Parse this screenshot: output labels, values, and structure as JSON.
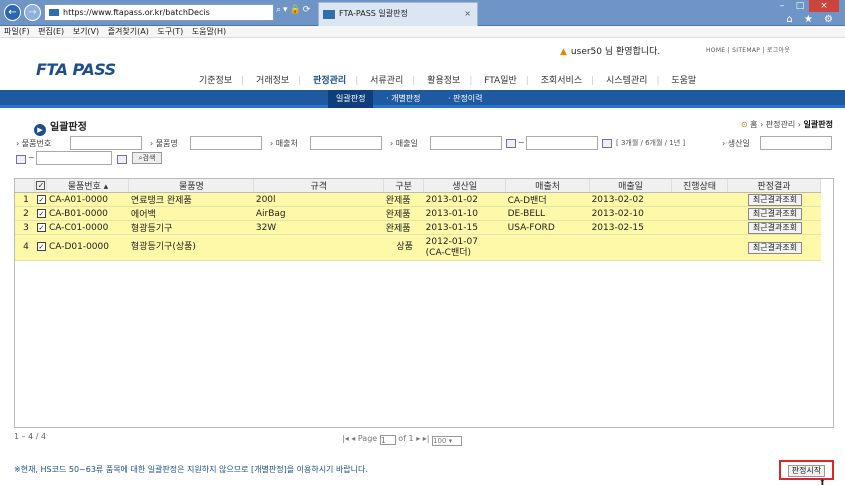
{
  "browser": {
    "url": "https://www.ftapass.or.kr/batchDecis",
    "tab_title": "FTA-PASS 일괄판정",
    "tab_close": "×",
    "back_glyph": "←",
    "fwd_glyph": "→",
    "menu": [
      "파일(F)",
      "편집(E)",
      "보기(V)",
      "즐겨찾기(A)",
      "도구(T)",
      "도움말(H)"
    ],
    "window_controls": [
      "–",
      "□",
      "×"
    ],
    "toolbar_icons": "⌂ ★ ⚙"
  },
  "header": {
    "logo": "FTA PASS",
    "welcome": "user50 님 환영합니다.",
    "top_links": "HOME | SITEMAP | 로그아웃",
    "nav": [
      "기준정보",
      "거래정보",
      "판정관리",
      "서류관리",
      "활용정보",
      "FTA일반",
      "조회서비스",
      "시스템관리",
      "도움말"
    ],
    "subnav": [
      "일괄판정",
      "· 개별판정",
      "· 판정이력"
    ]
  },
  "page": {
    "title": "일괄판정",
    "breadcrumb_home": "홈",
    "breadcrumb_mid": "› 판정관리 ›",
    "breadcrumb_current": "일괄판정"
  },
  "filters": {
    "product_no": "› 물품번호",
    "product_name": "› 물품명",
    "buyer": "› 매출처",
    "sale_date": "› 매출일",
    "tilde": "~",
    "periods": "[ 3개월 / 6개월 / 1년 ]",
    "prod_date": "› 생산일",
    "search": "검색"
  },
  "grid": {
    "headers": [
      "",
      "",
      "물품번호 ▴",
      "물품명",
      "규격",
      "구분",
      "생산일",
      "매출처",
      "매출일",
      "진행상태",
      "판정결과"
    ],
    "rows": [
      {
        "n": "1",
        "code": "CA-A01-0000",
        "name": "연료탱크 완제품",
        "spec": "200l",
        "type": "완제품",
        "prod": "2013-01-02",
        "buyer": "CA-D밴더",
        "sale": "2013-02-02",
        "status": "",
        "btn": "최근결과조회"
      },
      {
        "n": "2",
        "code": "CA-B01-0000",
        "name": "에어백",
        "spec": "AirBag",
        "type": "완제품",
        "prod": "2013-01-10",
        "buyer": "DE-BELL",
        "sale": "2013-02-10",
        "status": "",
        "btn": "최근결과조회"
      },
      {
        "n": "3",
        "code": "CA-C01-0000",
        "name": "형광등기구",
        "spec": "32W",
        "type": "완제품",
        "prod": "2013-01-15",
        "buyer": "USA-FORD",
        "sale": "2013-02-15",
        "status": "",
        "btn": "최근결과조회"
      },
      {
        "n": "4",
        "code": "CA-D01-0000",
        "name": "형광등기구(상품)",
        "spec": "",
        "type": "상품",
        "prod": "2012-01-07",
        "prod2": "(CA-C밴더)",
        "buyer": "",
        "sale": "",
        "status": "",
        "btn": "최근결과조회"
      }
    ],
    "check": "✓"
  },
  "footer": {
    "count": "1 – 4 / 4",
    "pager_prev": "|◂ ◂",
    "page_label": "Page",
    "page_value": "1",
    "of_label": "of 1",
    "pager_next": "▸ ▸|",
    "per_page": "100 ▾",
    "notice": "※현재, HS코드 50~63류 품목에 대한 일괄판정은 지원하지 않으므로 [개별판정]을 이용하시기 바랍니다.",
    "start_button": "판정시작"
  }
}
